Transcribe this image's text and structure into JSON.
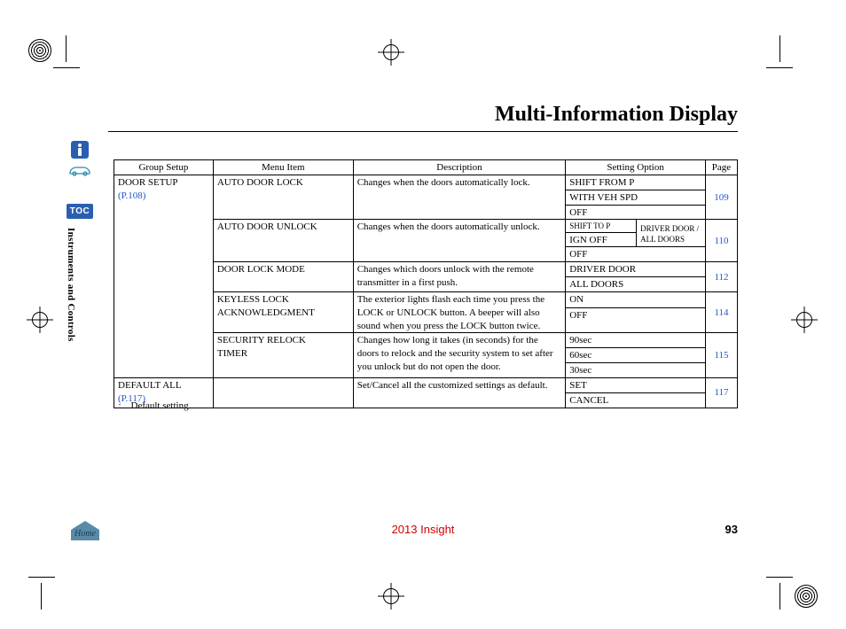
{
  "page_title": "Multi-Information Display",
  "section_label": "Instruments and Controls",
  "sidebar": {
    "toc_label": "TOC"
  },
  "table": {
    "headers": {
      "group": "Group Setup",
      "item": "Menu Item",
      "desc": "Description",
      "option": "Setting Option",
      "page": "Page"
    },
    "groups": [
      {
        "name": "DOOR SETUP",
        "ref": "(P.108)",
        "ref_page": "108"
      },
      {
        "name": "DEFAULT ALL",
        "ref": "(P.117)",
        "ref_page": "117"
      }
    ],
    "rows": {
      "r1": {
        "item": "AUTO DOOR LOCK",
        "desc": "Changes when the doors automatically lock.",
        "opts": [
          "SHIFT FROM P",
          "WITH VEH SPD",
          "OFF"
        ],
        "page": "109"
      },
      "r2": {
        "item": "AUTO DOOR UNLOCK",
        "desc": "Changes when the doors automatically unlock.",
        "opt_left": [
          "SHIFT TO P",
          "IGN OFF",
          "OFF"
        ],
        "opt_right": [
          "DRIVER DOOR  /",
          "ALL DOORS"
        ],
        "page": "110"
      },
      "r3": {
        "item": "DOOR LOCK MODE",
        "desc": "Changes which doors unlock with the remote transmitter in a first push.",
        "opts": [
          "DRIVER DOOR",
          "ALL DOORS"
        ],
        "page": "112"
      },
      "r4": {
        "item_l1": "KEYLESS LOCK",
        "item_l2": "ACKNOWLEDGMENT",
        "desc": "The exterior lights flash each time you press the LOCK or UNLOCK button. A beeper will also sound when you press the LOCK button twice.",
        "opts": [
          "ON",
          "OFF"
        ],
        "page": "114"
      },
      "r5": {
        "item_l1": "SECURITY RELOCK",
        "item_l2": "TIMER",
        "desc": "Changes how long it takes (in seconds) for the doors to relock and the security system to set after you unlock but do not open the door.",
        "opts": [
          "90sec",
          "60sec",
          "30sec"
        ],
        "page": "115"
      },
      "r6": {
        "desc": "Set/Cancel all the customized settings as default.",
        "opts": [
          "SET",
          "CANCEL"
        ],
        "page": "117"
      }
    }
  },
  "footnote": {
    "marker": ":",
    "text": "Default setting"
  },
  "footer": {
    "model": "2013 Insight",
    "page_number": "93",
    "home_label": "Home"
  }
}
